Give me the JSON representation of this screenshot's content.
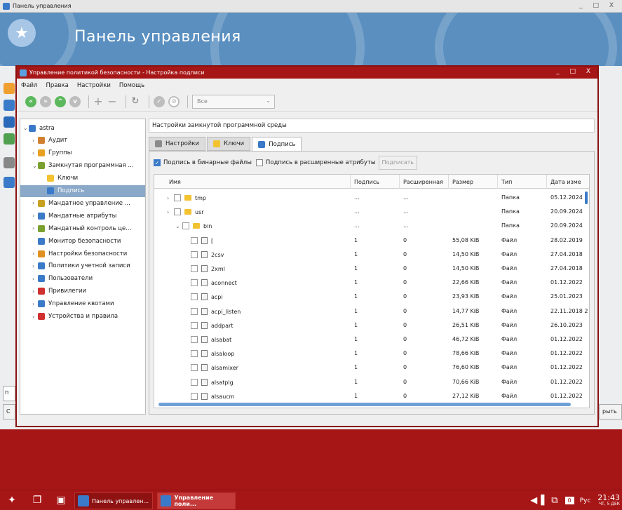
{
  "outer": {
    "title": "Панель управления",
    "banner_title": "Панель управления",
    "window_controls": "_ □ X",
    "search_stub": "П",
    "stub_left": "С",
    "stub_right": "рыть"
  },
  "dialog": {
    "title": "Управление политикой безопасности - Настройка подписи",
    "window_controls": "_ □ X",
    "menu": [
      "Файл",
      "Правка",
      "Настройки",
      "Помощь"
    ],
    "toolbar": {
      "combo_value": "Все",
      "icons": [
        "back-icon",
        "forward-icon",
        "up-icon",
        "down-icon",
        "add-icon",
        "remove-icon",
        "refresh-icon",
        "apply-icon",
        "cancel-icon"
      ]
    }
  },
  "tree": [
    {
      "label": "astra",
      "expander": "⌄",
      "level": 0
    },
    {
      "label": "Аудит",
      "expander": "›",
      "level": 1
    },
    {
      "label": "Группы",
      "expander": "›",
      "level": 1
    },
    {
      "label": "Замкнутая программная ...",
      "expander": "⌄",
      "level": 1
    },
    {
      "label": "Ключи",
      "expander": "",
      "level": 2
    },
    {
      "label": "Подпись",
      "expander": "",
      "level": 2,
      "selected": true
    },
    {
      "label": "Мандатное управление ...",
      "expander": "›",
      "level": 1
    },
    {
      "label": "Мандатные атрибуты",
      "expander": "›",
      "level": 1
    },
    {
      "label": "Мандатный контроль це...",
      "expander": "›",
      "level": 1
    },
    {
      "label": "Монитор безопасности",
      "expander": "",
      "level": 1
    },
    {
      "label": "Настройки безопасности",
      "expander": "›",
      "level": 1
    },
    {
      "label": "Политики учетной записи",
      "expander": "›",
      "level": 1
    },
    {
      "label": "Пользователи",
      "expander": "›",
      "level": 1
    },
    {
      "label": "Привилегии",
      "expander": "›",
      "level": 1
    },
    {
      "label": "Управление квотами",
      "expander": "›",
      "level": 1
    },
    {
      "label": "Устройства и правила",
      "expander": "›",
      "level": 1
    }
  ],
  "breadcrumb": "Настройки замкнутой программной среды",
  "tabs": [
    "Настройки",
    "Ключи",
    "Подпись"
  ],
  "options": {
    "binary_label": "Подпись в бинарные файлы",
    "binary_checked": true,
    "xattr_label": "Подпись в расширенные атрибуты",
    "xattr_checked": false,
    "sign_button": "Подписать"
  },
  "table": {
    "headers": [
      "Имя",
      "Подпись",
      "Расширенная",
      "Размер",
      "Тип",
      "Дата изме"
    ],
    "rows": [
      {
        "exp": "›",
        "kind": "folder",
        "level": 0,
        "name": "tmp",
        "sig": "...",
        "ext": "...",
        "size": "",
        "type": "Папка",
        "date": "05.12.2024"
      },
      {
        "exp": "›",
        "kind": "folder",
        "level": 0,
        "name": "usr",
        "sig": "...",
        "ext": "...",
        "size": "",
        "type": "Папка",
        "date": "20.09.2024"
      },
      {
        "exp": "⌄",
        "kind": "folder",
        "level": 1,
        "name": "bin",
        "sig": "...",
        "ext": "...",
        "size": "",
        "type": "Папка",
        "date": "20.09.2024"
      },
      {
        "exp": "",
        "kind": "file",
        "level": 2,
        "name": "[",
        "sig": "1",
        "ext": "0",
        "size": "55,08 KiB",
        "type": "Файл",
        "date": "28.02.2019"
      },
      {
        "exp": "",
        "kind": "file",
        "level": 2,
        "name": "2csv",
        "sig": "1",
        "ext": "0",
        "size": "14,50 KiB",
        "type": "Файл",
        "date": "27.04.2018"
      },
      {
        "exp": "",
        "kind": "file",
        "level": 2,
        "name": "2xml",
        "sig": "1",
        "ext": "0",
        "size": "14,50 KiB",
        "type": "Файл",
        "date": "27.04.2018"
      },
      {
        "exp": "",
        "kind": "file",
        "level": 2,
        "name": "aconnect",
        "sig": "1",
        "ext": "0",
        "size": "22,66 KiB",
        "type": "Файл",
        "date": "01.12.2022"
      },
      {
        "exp": "",
        "kind": "file",
        "level": 2,
        "name": "acpi",
        "sig": "1",
        "ext": "0",
        "size": "23,93 KiB",
        "type": "Файл",
        "date": "25.01.2023"
      },
      {
        "exp": "",
        "kind": "file",
        "level": 2,
        "name": "acpi_listen",
        "sig": "1",
        "ext": "0",
        "size": "14,77 KiB",
        "type": "Файл",
        "date": "22.11.2018 2"
      },
      {
        "exp": "",
        "kind": "file",
        "level": 2,
        "name": "addpart",
        "sig": "1",
        "ext": "0",
        "size": "26,51 KiB",
        "type": "Файл",
        "date": "26.10.2023"
      },
      {
        "exp": "",
        "kind": "file",
        "level": 2,
        "name": "alsabat",
        "sig": "1",
        "ext": "0",
        "size": "46,72 KiB",
        "type": "Файл",
        "date": "01.12.2022"
      },
      {
        "exp": "",
        "kind": "file",
        "level": 2,
        "name": "alsaloop",
        "sig": "1",
        "ext": "0",
        "size": "78,66 KiB",
        "type": "Файл",
        "date": "01.12.2022"
      },
      {
        "exp": "",
        "kind": "file",
        "level": 2,
        "name": "alsamixer",
        "sig": "1",
        "ext": "0",
        "size": "76,60 KiB",
        "type": "Файл",
        "date": "01.12.2022"
      },
      {
        "exp": "",
        "kind": "file",
        "level": 2,
        "name": "alsatplg",
        "sig": "1",
        "ext": "0",
        "size": "70,66 KiB",
        "type": "Файл",
        "date": "01.12.2022"
      },
      {
        "exp": "",
        "kind": "file",
        "level": 2,
        "name": "alsaucm",
        "sig": "1",
        "ext": "0",
        "size": "27,12 KiB",
        "type": "Файл",
        "date": "01.12.2022"
      }
    ]
  },
  "taskbar": {
    "task1": "Панель управлен...",
    "task2": "Управление поли...",
    "lang": "Рус",
    "badge": "0",
    "time": "21:43",
    "date": "ЧТ, 5 ДЕК"
  },
  "colors": {
    "accent_red": "#a71616",
    "selection": "#8aa8c8",
    "banner": "#5a8fc0"
  }
}
